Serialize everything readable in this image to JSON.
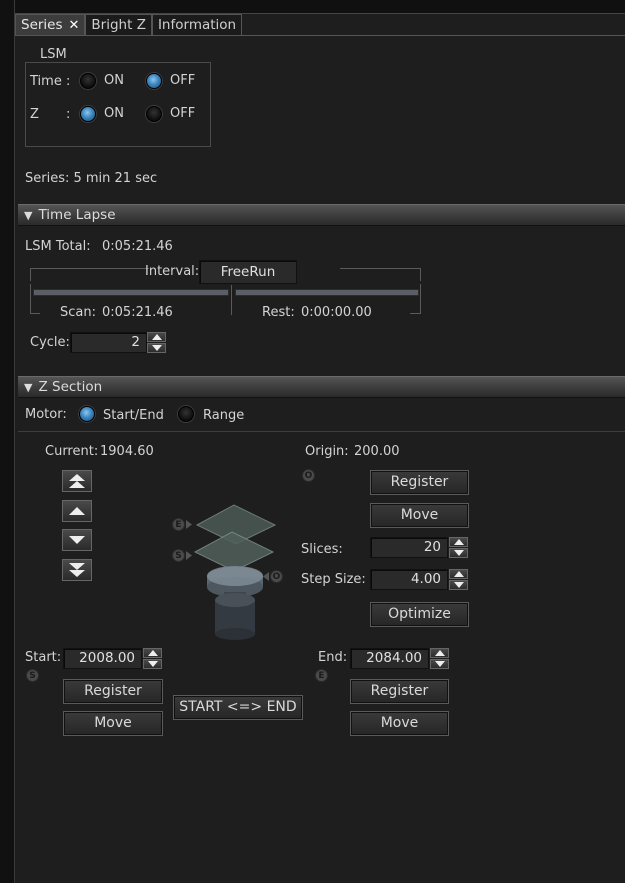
{
  "tabs": [
    {
      "label": "Series",
      "active": true,
      "closable": true
    },
    {
      "label": "Bright Z",
      "active": false
    },
    {
      "label": "Information",
      "active": false
    }
  ],
  "lsm": {
    "legend": "LSM",
    "time_label": "Time :",
    "z_label": "Z",
    "z_colon": ":",
    "on_label": "ON",
    "off_label": "OFF",
    "time_selected": "OFF",
    "z_selected": "ON"
  },
  "series_summary": "Series:  5 min 21 sec",
  "time_lapse": {
    "header": "Time Lapse",
    "lsm_total_label": "LSM Total:",
    "lsm_total_value": "0:05:21.46",
    "interval_label": "Interval:",
    "interval_value": "FreeRun",
    "scan_label": "Scan:",
    "scan_value": "0:05:21.46",
    "rest_label": "Rest:",
    "rest_value": "0:00:00.00",
    "cycle_label": "Cycle:",
    "cycle_value": "2"
  },
  "z_section": {
    "header": "Z Section",
    "motor_label": "Motor:",
    "motor_options": [
      "Start/End",
      "Range"
    ],
    "motor_selected": "Start/End",
    "current_label": "Current:",
    "current_value": "1904.60",
    "origin_label": "Origin:",
    "origin_value": "200.00",
    "register_label": "Register",
    "move_label": "Move",
    "slices_label": "Slices:",
    "slices_value": "20",
    "step_size_label": "Step Size:",
    "step_size_value": "4.00",
    "optimize_label": "Optimize",
    "start_label": "Start:",
    "start_value": "2008.00",
    "end_label": "End:",
    "end_value": "2084.00",
    "swap_label": "START <=> END",
    "badge_s": "S",
    "badge_e": "E",
    "badge_o": "O"
  },
  "colors": {
    "background": "#1e1e1e",
    "accent_radio": "#3d86c0",
    "text": "#d4d4d4"
  }
}
